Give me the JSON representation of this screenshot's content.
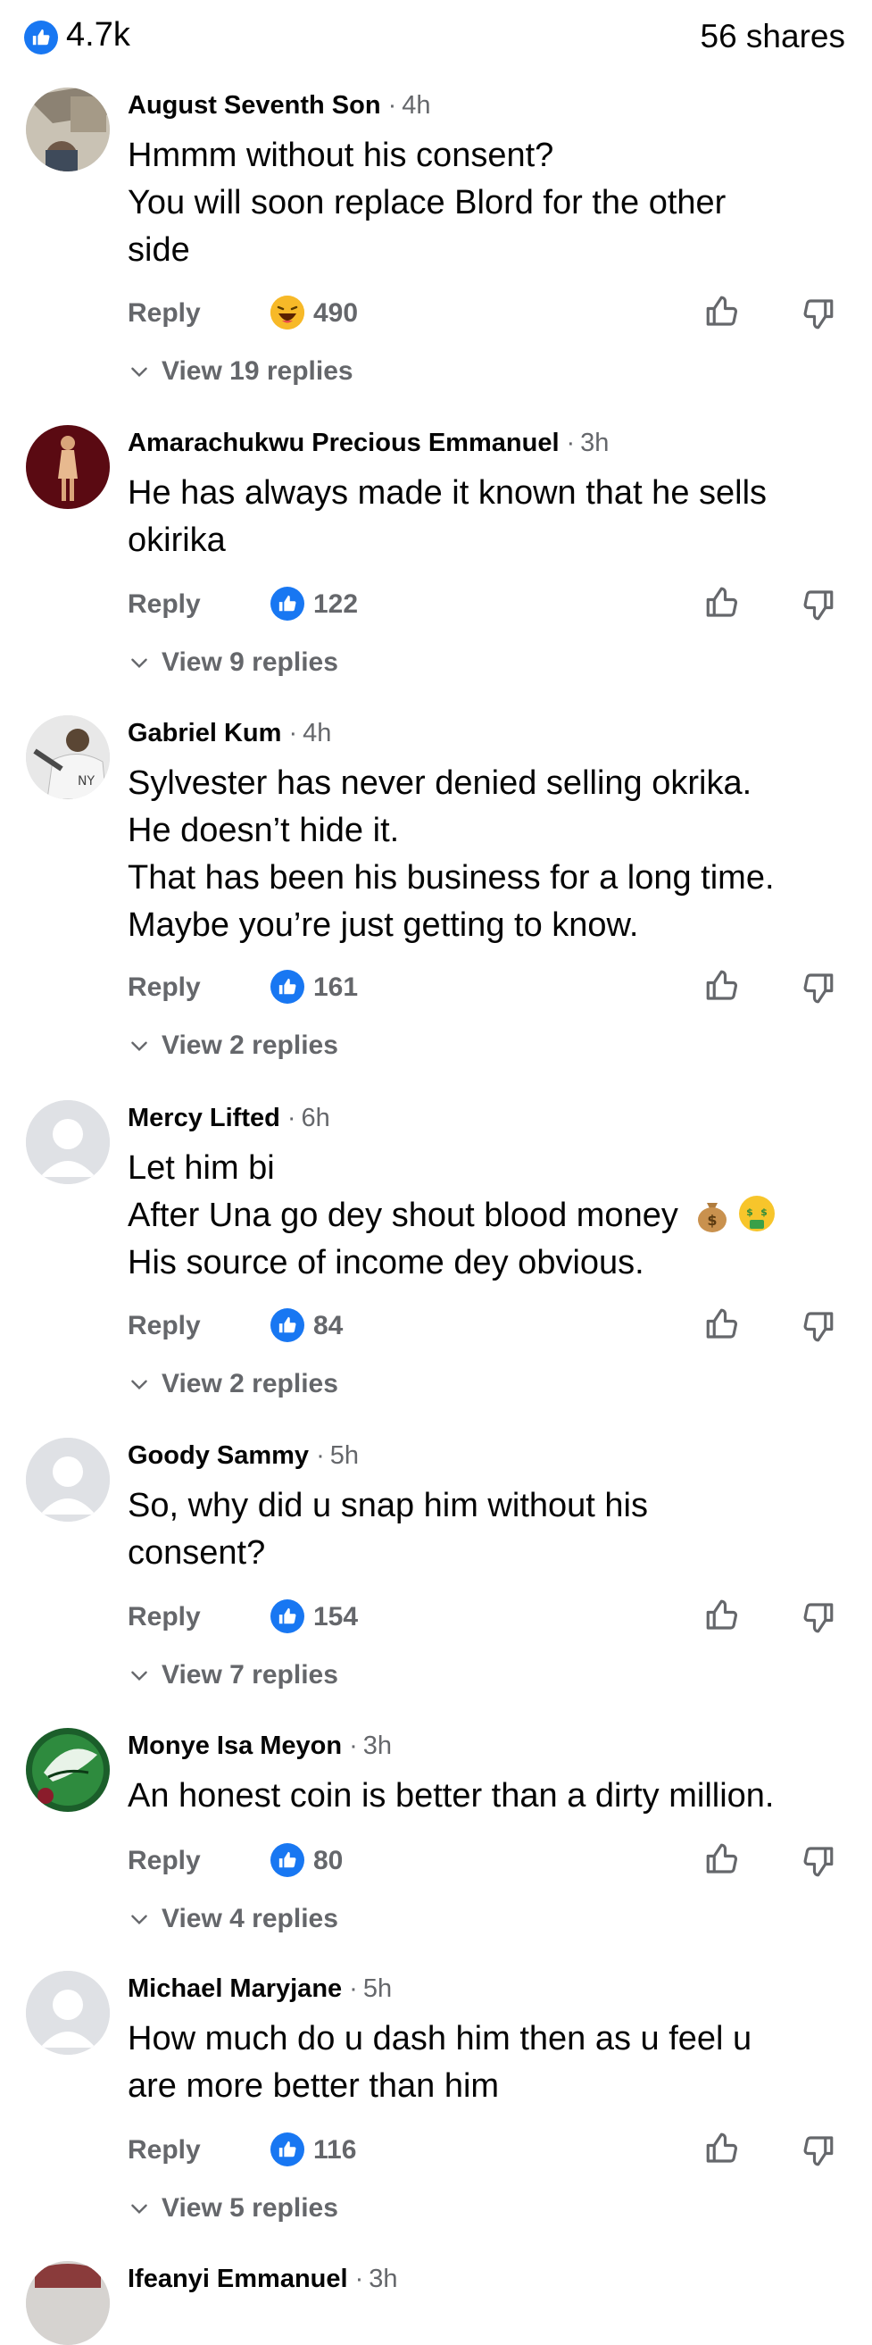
{
  "post_stats": {
    "likes": "4.7k",
    "shares": "56 shares"
  },
  "ui": {
    "reply_label": "Reply",
    "dot": "·"
  },
  "colors": {
    "facebook_blue": "#1877f2",
    "secondary_text": "#65676b"
  },
  "comments": [
    {
      "author": "August Seventh Son",
      "time": "4h",
      "lines": [
        "Hmmm without his consent?",
        "You will soon replace Blord for the other",
        "side"
      ],
      "reaction_icon": "haha-emoji-icon",
      "reaction_count": "490",
      "replies": "View 19 replies"
    },
    {
      "author": "Amarachukwu Precious Emmanuel",
      "time": "3h",
      "lines": [
        "He has always made it known that he sells",
        "okirika"
      ],
      "reaction_icon": "like-icon",
      "reaction_count": "122",
      "replies": "View 9 replies"
    },
    {
      "author": "Gabriel Kum",
      "time": "4h",
      "lines": [
        "Sylvester has never denied selling okrika.",
        "He doesn’t hide it.",
        "That has been his business for a long time.",
        "Maybe you’re just getting to know."
      ],
      "reaction_icon": "like-icon",
      "reaction_count": "161",
      "replies": "View 2 replies"
    },
    {
      "author": "Mercy Lifted",
      "time": "6h",
      "lines": [
        "Let him bi",
        "After Una go dey shout blood money",
        "His source of income dey obvious."
      ],
      "emojis_line_2": [
        "money-bag-emoji",
        "money-mouth-face-emoji"
      ],
      "reaction_icon": "like-icon",
      "reaction_count": "84",
      "replies": "View 2 replies"
    },
    {
      "author": "Goody Sammy",
      "time": "5h",
      "lines": [
        "So, why did u snap him without his",
        "consent?"
      ],
      "reaction_icon": "like-icon",
      "reaction_count": "154",
      "replies": "View 7 replies"
    },
    {
      "author": "Monye Isa Meyon",
      "time": "3h",
      "lines": [
        "An honest coin is better than a dirty million."
      ],
      "reaction_icon": "like-icon",
      "reaction_count": "80",
      "replies": "View 4 replies"
    },
    {
      "author": "Michael Maryjane",
      "time": "5h",
      "lines": [
        "How much do u dash him then as u feel u",
        "are more better than him"
      ],
      "reaction_icon": "like-icon",
      "reaction_count": "116",
      "replies": "View 5 replies"
    },
    {
      "author": "Ifeanyi Emmanuel",
      "time": "3h",
      "lines": [],
      "reaction_icon": "",
      "reaction_count": "",
      "replies": ""
    }
  ]
}
